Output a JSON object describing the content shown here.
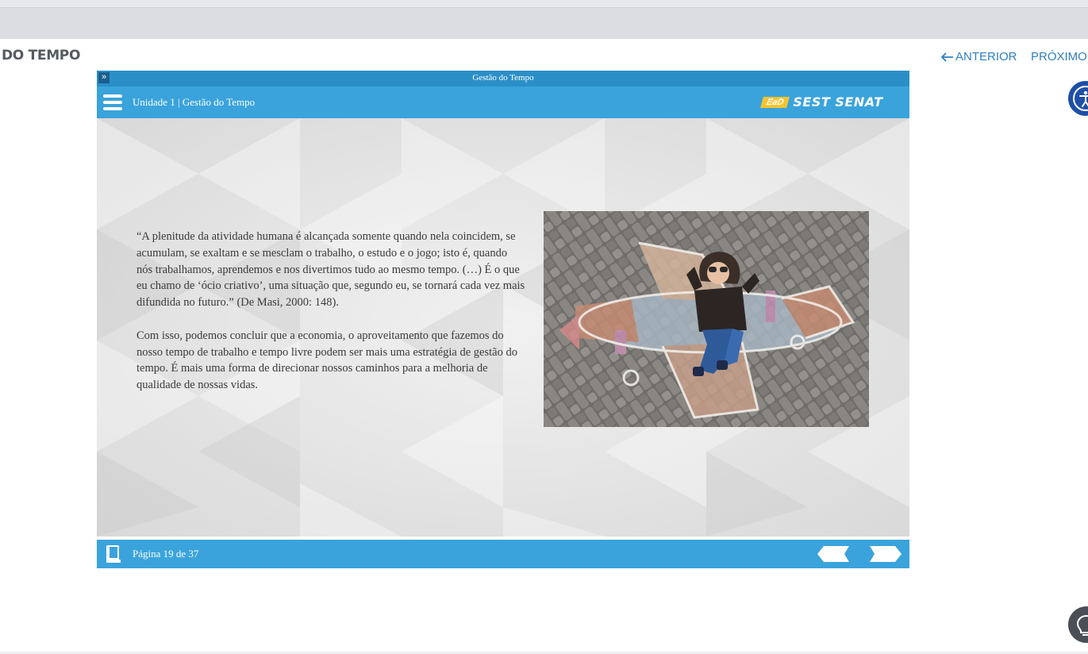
{
  "page": {
    "heading": "DO TEMPO",
    "nav_prev_label": "ANTERIOR",
    "nav_next_label": "PRÓXIMO"
  },
  "viewer": {
    "title": "Gestão do Tempo",
    "unit_title": "Unidade 1 | Gestão do Tempo",
    "logo_ead": "EaD",
    "logo_brand": "SEST SENAT",
    "paragraphs": [
      "“A plenitude da atividade humana é alcançada somente quando nela coincidem, se acumulam, se exaltam e se mesclam o trabalho, o estudo e o jogo; isto é, quando nós trabalhamos, aprendemos e nos divertimos tudo ao mesmo tempo. (…) É o que eu chamo de ‘ócio criativo’, uma situação que, segundo eu, se tornará cada vez mais difundida no futuro.” (De Masi, 2000: 148).",
      "Com isso, podemos concluir que a economia, o aproveitamento que fazemos do nosso tempo de trabalho e tempo livre podem ser mais uma estratégia de gestão do tempo. É mais uma forma de direcionar nossos caminhos para a melhoria de qualidade de nossas vidas."
    ],
    "page_count": "Página 19 de 37"
  },
  "colors": {
    "accent": "#3aa3dc",
    "title_strip": "#2b8fc7",
    "link": "#2f7fc1",
    "accessibility": "#1e4fa8"
  },
  "icons": [
    "arrow-left-icon",
    "expand-icon",
    "hamburger-menu-icon",
    "book-icon",
    "prev-page-arrow-icon",
    "next-page-arrow-icon",
    "accessibility-icon",
    "lightbulb-icon"
  ]
}
